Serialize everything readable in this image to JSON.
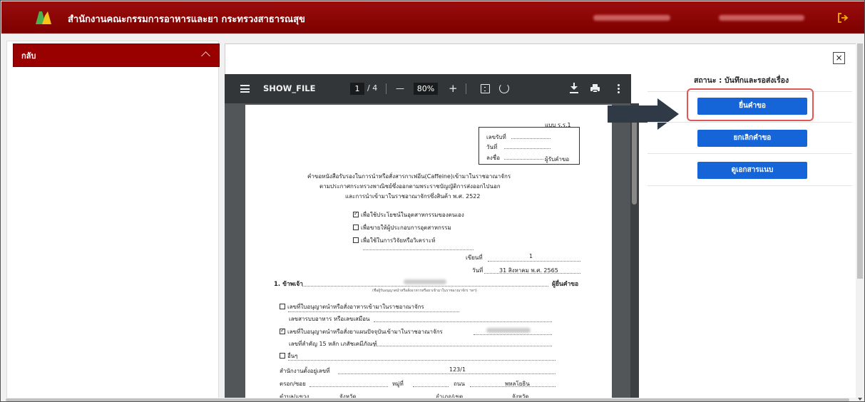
{
  "header": {
    "org_name": "สำนักงานคณะกรรมการอาหารและยา กระทรวงสาธารณสุข",
    "logout_icon": "logout-icon",
    "brand_color": "#8b0000"
  },
  "sidebar": {
    "back_label": "กลับ"
  },
  "viewer": {
    "file_name": "SHOW_FILE",
    "page_current": "1",
    "page_total": "/ 4",
    "zoom": "80%",
    "zoom_out": "—",
    "zoom_in": "+"
  },
  "document": {
    "form_code": "แบบ ร.ร.1",
    "receipt": {
      "received_no": "เลขรับที่",
      "date": "วันที่",
      "signature": "ลงชื่อ",
      "receiver": "ผู้รับคำขอ"
    },
    "title_lines": [
      "คำขอหนังสือรับรองในการนำหรือสั่งสารกาเฟอีน(Caffeine)เข้ามาในราชอาณาจักร",
      "ตามประกาศกระทรวงพาณิชย์ซึ่งออกตามพระราชบัญญัติการส่งออกไปนอก",
      "และการนำเข้ามาในราชอาณาจักรซึ่งสินค้า พ.ศ. 2522"
    ],
    "purposes": [
      "เพื่อใช้ประโยชน์ในอุตสาหกรรมของตนเอง",
      "เพื่อขายให้ผู้ประกอบการอุตสาหกรรม",
      "เพื่อใช้ในการวิจัยหรือวิเคราะห์"
    ],
    "written_at_label": "เขียนที่",
    "written_at_value": "1",
    "date_label": "วันที่",
    "date_value": "31 สิงหาคม พ.ศ. 2565",
    "applicant_label": "1. ข้าพเจ้า",
    "applicant_suffix": "ผู้ยื่นคำขอ",
    "applicant_note": "(ชื่อผู้รับอนุญาตนำหรือสั่งอาหารหรือยาเข้ามาในราชอาณาจักร ฯลฯ)",
    "licenses": [
      "เลขที่ใบอนุญาตนำหรือสั่งอาหารเข้ามาในราชอาณาจักร",
      "เลขสารบบอาหาร หรือเลขเสมือน",
      "เลขที่ใบอนุญาตนำหรือสั่งยาแผนปัจจุบันเข้ามาในราชอาณาจักร",
      "เลขที่สำคัญ 15 หลัก เภสัชเคมีภัณฑ์",
      "อื่นๆ"
    ],
    "office_label": "สำนักงานตั้งอยู่เลขที่",
    "office_value": "123/1",
    "alley_label": "ตรอก/ซอย",
    "moo_label": "หมู่ที่",
    "road_label": "ถนน",
    "road_value": "พหลโยธิน",
    "subdistrict_label": "ตำบล/แขวง",
    "province_label_1": "จังหวัด",
    "district_label": "อำเภอ/เขต",
    "province_label_2": "จังหวัด"
  },
  "status": {
    "text": "สถานะ : บันทึกและรอส่งเรื่อง"
  },
  "actions": {
    "submit": "ยื่นคำขอ",
    "cancel": "ยกเลิกคำขอ",
    "attachments": "ดูเอกสารแนบ"
  },
  "close_label": "×"
}
